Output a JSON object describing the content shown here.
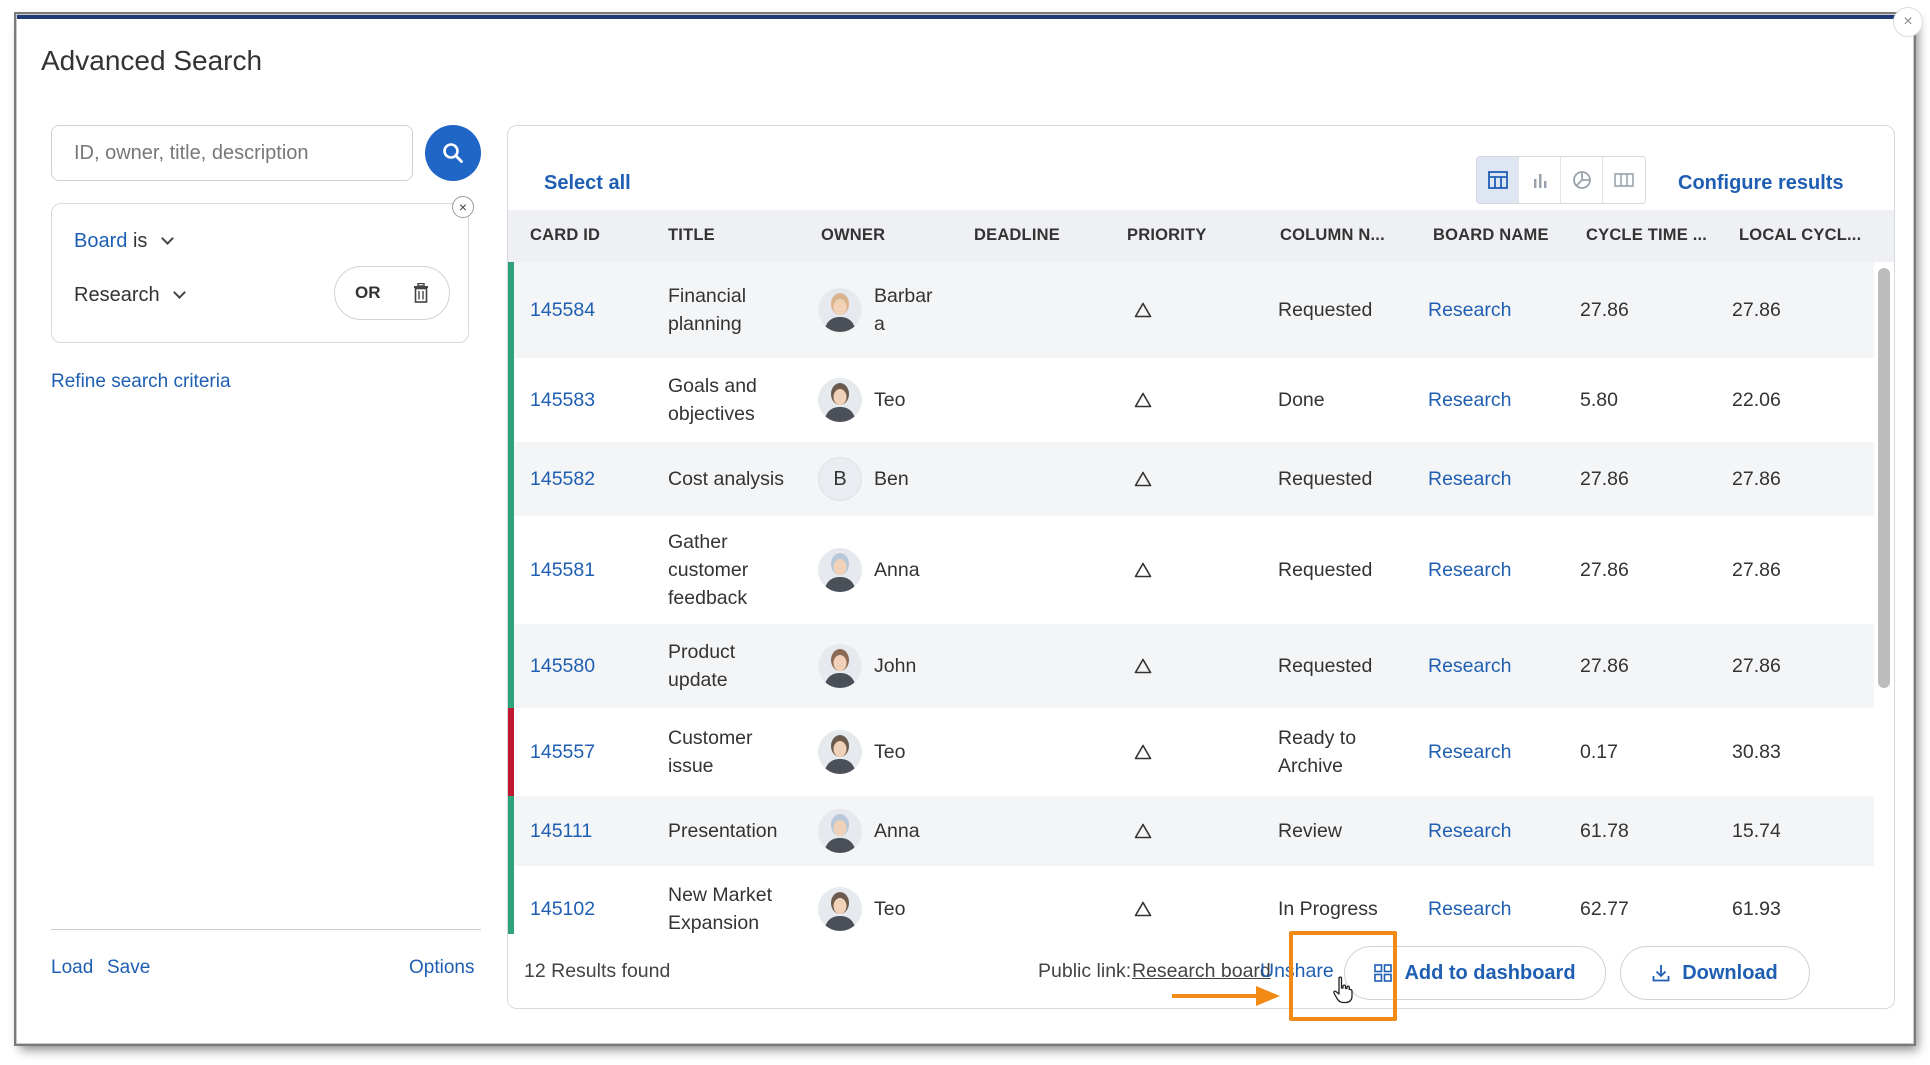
{
  "dialog": {
    "title": "Advanced Search",
    "close_glyph": "×"
  },
  "search": {
    "placeholder": "ID, owner, title, description",
    "icon": "search-icon"
  },
  "filter": {
    "field": "Board",
    "operator": "is",
    "value": "Research",
    "or_label": "OR",
    "close_glyph": "×"
  },
  "left_panel": {
    "refine_label": "Refine search criteria",
    "load_label": "Load",
    "save_label": "Save",
    "options_label": "Options"
  },
  "toolbar": {
    "select_all_label": "Select all",
    "configure_label": "Configure results",
    "views": [
      "table-view-icon",
      "bar-chart-icon",
      "pie-chart-icon",
      "columns-view-icon"
    ],
    "active_view": "table-view-icon"
  },
  "table": {
    "columns": [
      "CARD ID",
      "TITLE",
      "OWNER",
      "DEADLINE",
      "PRIORITY",
      "COLUMN N...",
      "BOARD NAME",
      "CYCLE TIME ...",
      "LOCAL CYCL..."
    ],
    "rows": [
      {
        "id": "145584",
        "title_lines": [
          "Financial",
          "planning"
        ],
        "owner_lines": [
          "Barbar",
          "a"
        ],
        "avatar": "photo",
        "avatar_color": "#d9b48f",
        "column_lines": [
          "Requested"
        ],
        "board": "Research",
        "cycle": "27.86",
        "local": "27.86",
        "bar_color": "#2ea37a"
      },
      {
        "id": "145583",
        "title_lines": [
          "Goals and",
          "objectives"
        ],
        "owner_lines": [
          "Teo"
        ],
        "avatar": "photo",
        "avatar_color": "#6b5a4e",
        "column_lines": [
          "Done"
        ],
        "board": "Research",
        "cycle": "5.80",
        "local": "22.06",
        "bar_color": "#2ea37a"
      },
      {
        "id": "145582",
        "title_lines": [
          "Cost analysis"
        ],
        "owner_lines": [
          "Ben"
        ],
        "avatar": "letter",
        "avatar_letter": "B",
        "column_lines": [
          "Requested"
        ],
        "board": "Research",
        "cycle": "27.86",
        "local": "27.86",
        "bar_color": "#2ea37a"
      },
      {
        "id": "145581",
        "title_lines": [
          "Gather",
          "customer",
          "feedback"
        ],
        "owner_lines": [
          "Anna"
        ],
        "avatar": "photo",
        "avatar_color": "#b9c8d8",
        "column_lines": [
          "Requested"
        ],
        "board": "Research",
        "cycle": "27.86",
        "local": "27.86",
        "bar_color": "#2ea37a"
      },
      {
        "id": "145580",
        "title_lines": [
          "Product",
          "update"
        ],
        "owner_lines": [
          "John"
        ],
        "avatar": "photo",
        "avatar_color": "#8a6a55",
        "column_lines": [
          "Requested"
        ],
        "board": "Research",
        "cycle": "27.86",
        "local": "27.86",
        "bar_color": "#2ea37a"
      },
      {
        "id": "145557",
        "title_lines": [
          "Customer",
          "issue"
        ],
        "owner_lines": [
          "Teo"
        ],
        "avatar": "photo",
        "avatar_color": "#6b5a4e",
        "column_lines": [
          "Ready to",
          "Archive"
        ],
        "board": "Research",
        "cycle": "0.17",
        "local": "30.83",
        "bar_color": "#c0182f"
      },
      {
        "id": "145111",
        "title_lines": [
          "Presentation"
        ],
        "owner_lines": [
          "Anna"
        ],
        "avatar": "photo",
        "avatar_color": "#b9c8d8",
        "column_lines": [
          "Review"
        ],
        "board": "Research",
        "cycle": "61.78",
        "local": "15.74",
        "bar_color": "#2ea37a"
      },
      {
        "id": "145102",
        "title_lines": [
          "New Market",
          "Expansion"
        ],
        "owner_lines": [
          "Teo"
        ],
        "avatar": "photo",
        "avatar_color": "#6b5a4e",
        "column_lines": [
          "In Progress"
        ],
        "board": "Research",
        "cycle": "62.77",
        "local": "61.93",
        "bar_color": "#2ea37a"
      }
    ],
    "priority_icon": "triangle-outline-icon"
  },
  "footer": {
    "results_count": "12 Results found",
    "public_link_label": "Public link:",
    "public_link_text": "Research board",
    "unshare_label": "Unshare",
    "add_dashboard_label": "Add to dashboard",
    "download_label": "Download"
  },
  "colors": {
    "accent": "#1f5fb3",
    "primary_button": "#1f66c7",
    "annotation": "#f28a16",
    "status_green": "#2ea37a",
    "status_red": "#c0182f"
  }
}
